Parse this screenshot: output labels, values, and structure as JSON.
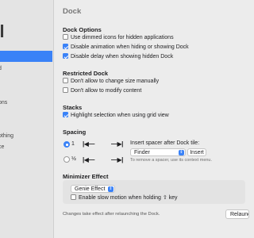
{
  "sidebar": {
    "app_title": "ol",
    "items": [
      {
        "label": "",
        "selected": true
      },
      {
        "label": "d"
      },
      {
        "label": "ons"
      },
      {
        "label": "othing"
      },
      {
        "label": "ce"
      }
    ]
  },
  "page": {
    "title": "Dock",
    "dock_options": {
      "heading": "Dock Options",
      "items": [
        {
          "label": "Use dimmed icons for hidden applications",
          "checked": false
        },
        {
          "label": "Disable animation when hiding or showing Dock",
          "checked": true
        },
        {
          "label": "Disable delay when showing hidden Dock",
          "checked": true
        }
      ]
    },
    "restricted_dock": {
      "heading": "Restricted Dock",
      "items": [
        {
          "label": "Don't allow to change size manually",
          "checked": false
        },
        {
          "label": "Don't allow to modify content",
          "checked": false
        }
      ]
    },
    "stacks": {
      "heading": "Stacks",
      "items": [
        {
          "label": "Highlight selection when using grid view",
          "checked": true
        }
      ]
    },
    "spacing": {
      "heading": "Spacing",
      "option_1_label": "1",
      "option_half_label": "½",
      "shrink_glyph": "|◀—",
      "expand_glyph": "—▶|",
      "insert_label": "Insert spacer after Dock tile:",
      "app_select_value": "Finder",
      "insert_button": "Insert",
      "hint": "To remove a spacer, use its context menu."
    },
    "minimizer": {
      "heading": "Minimizer Effect",
      "effect_value": "Genie Effect",
      "slow_motion_label": "Enable slow motion when holding ⇧ key",
      "slow_motion_checked": false
    },
    "footer_text": "Changes take effect after relaunching the Dock.",
    "relaunch_button": "Relaunch Dock"
  },
  "colors": {
    "accent": "#3a82f7",
    "sidebar_bg": "#e4e4e4",
    "main_bg": "#ececec"
  }
}
